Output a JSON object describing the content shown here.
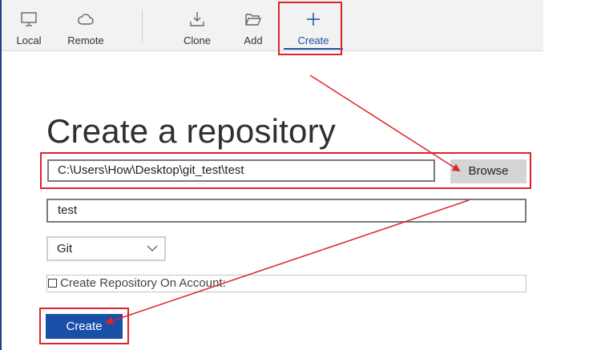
{
  "toolbar": {
    "items": [
      {
        "label": "Local",
        "icon": "monitor-icon"
      },
      {
        "label": "Remote",
        "icon": "cloud-icon"
      },
      {
        "label": "Clone",
        "icon": "download-icon"
      },
      {
        "label": "Add",
        "icon": "folder-open-icon"
      },
      {
        "label": "Create",
        "icon": "plus-icon",
        "active": true
      }
    ]
  },
  "main": {
    "title": "Create a repository",
    "path_value": "C:\\Users\\How\\Desktop\\git_test\\test",
    "browse_label": "Browse",
    "name_value": "test",
    "type_selected": "Git",
    "account_checkbox_label": "Create Repository On Account:",
    "account_checked": false,
    "create_label": "Create"
  },
  "colors": {
    "accent": "#1a4fa8",
    "annotation": "#e0232b",
    "browse_bg": "#d4d4d4"
  }
}
